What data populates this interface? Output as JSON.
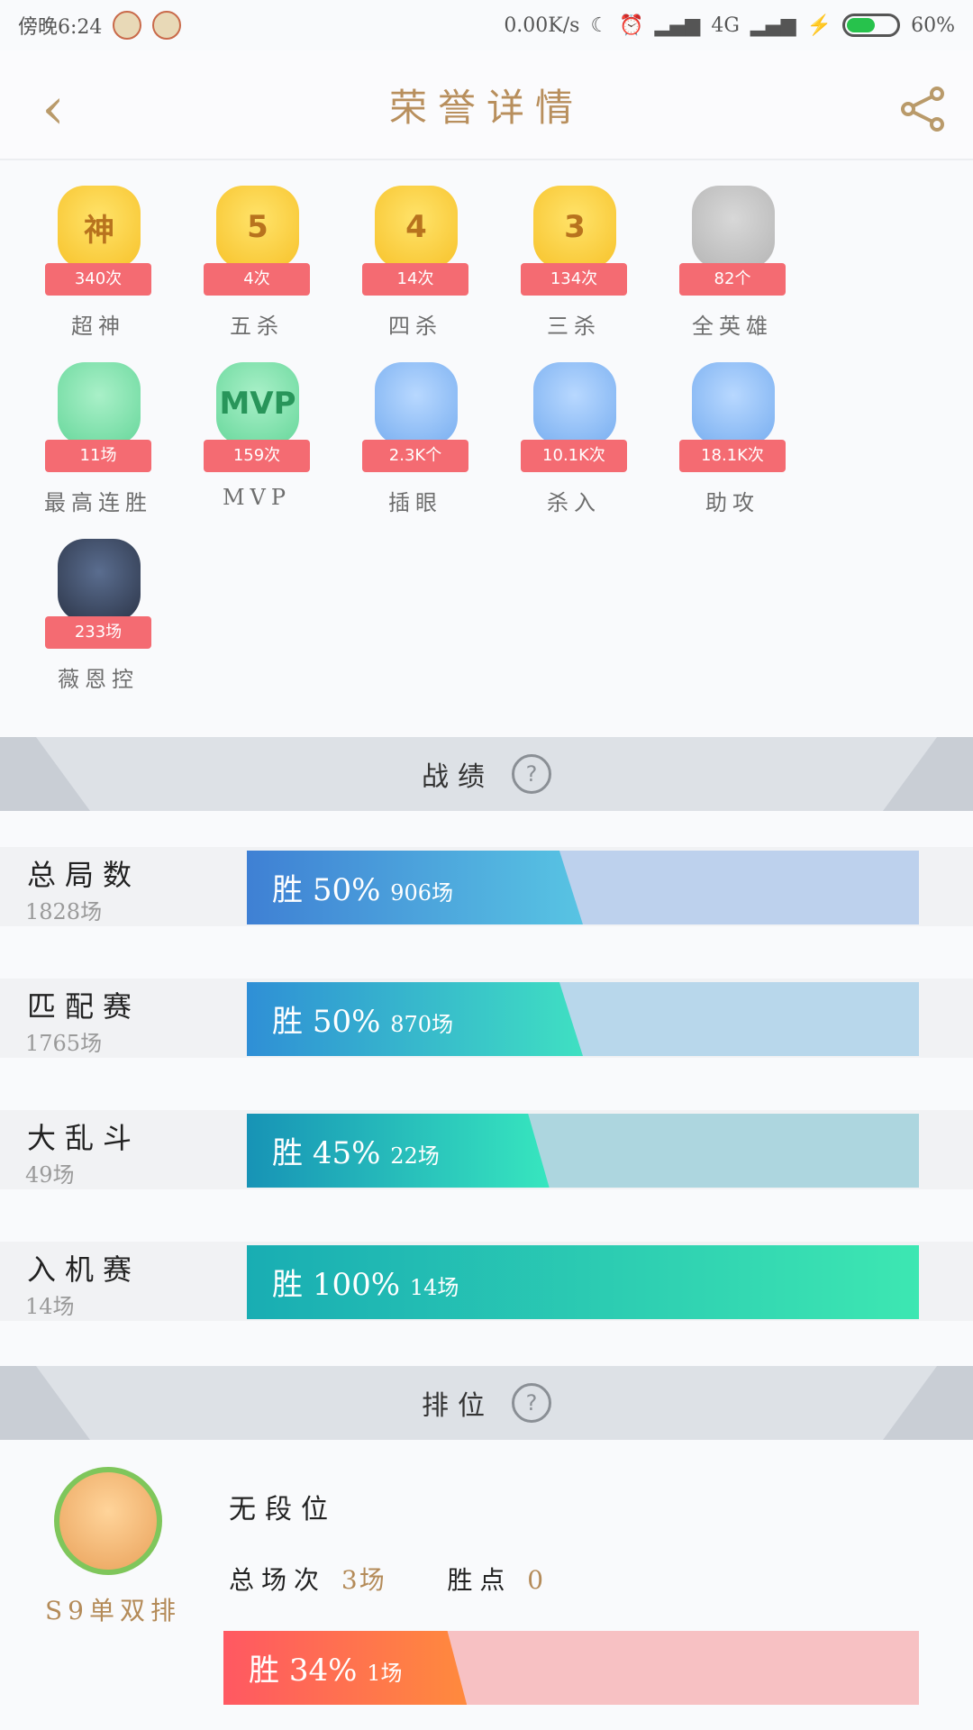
{
  "status_bar": {
    "time": "傍晚6:24",
    "net_speed": "0.00K/s",
    "signal": "4G",
    "battery": "60%",
    "battery_level": 0.6
  },
  "header": {
    "title": "荣誉详情"
  },
  "honors": [
    {
      "label": "超神",
      "count": "340次",
      "badge_text": "神",
      "color": "gold"
    },
    {
      "label": "五杀",
      "count": "4次",
      "badge_text": "5",
      "color": "gold"
    },
    {
      "label": "四杀",
      "count": "14次",
      "badge_text": "4",
      "color": "gold"
    },
    {
      "label": "三杀",
      "count": "134次",
      "badge_text": "3",
      "color": "gold"
    },
    {
      "label": "全英雄",
      "count": "82个",
      "badge_text": "",
      "color": "gray"
    },
    {
      "label": "最高连胜",
      "count": "11场",
      "badge_text": "",
      "color": "green"
    },
    {
      "label": "MVP",
      "count": "159次",
      "badge_text": "MVP",
      "color": "green"
    },
    {
      "label": "插眼",
      "count": "2.3K个",
      "badge_text": "",
      "color": "blue"
    },
    {
      "label": "杀入",
      "count": "10.1K次",
      "badge_text": "",
      "color": "blue"
    },
    {
      "label": "助攻",
      "count": "18.1K次",
      "badge_text": "",
      "color": "blue"
    },
    {
      "label": "薇恩控",
      "count": "233场",
      "badge_text": "",
      "color": "avatar"
    }
  ],
  "stats_section": {
    "title": "战绩",
    "help": "?"
  },
  "stats": [
    {
      "name": "总局数",
      "total": "1828场",
      "win_label": "胜",
      "win_rate_text": "50%",
      "win_games": "906场",
      "win_rate": 0.5,
      "color_from": "#3f80d4",
      "color_to": "#58c4e3",
      "track": "#bdd1ed"
    },
    {
      "name": "匹配赛",
      "total": "1765场",
      "win_label": "胜",
      "win_rate_text": "50%",
      "win_games": "870场",
      "win_rate": 0.5,
      "color_from": "#2f8fd6",
      "color_to": "#3fe0c2",
      "track": "#b8d7eb"
    },
    {
      "name": "大乱斗",
      "total": "49场",
      "win_label": "胜",
      "win_rate_text": "45%",
      "win_games": "22场",
      "win_rate": 0.45,
      "color_from": "#1793b6",
      "color_to": "#37e6bf",
      "track": "#add6df"
    },
    {
      "name": "入机赛",
      "total": "14场",
      "win_label": "胜",
      "win_rate_text": "100%",
      "win_games": "14场",
      "win_rate": 1.0,
      "color_from": "#19adb3",
      "color_to": "#3de7b2",
      "track": "#b1e2de"
    }
  ],
  "rank_section": {
    "title": "排位",
    "help": "?",
    "season": "S9单双排",
    "tier": "无段位",
    "total_label": "总场次",
    "total_value": "3场",
    "points_label": "胜点",
    "points_value": "0",
    "win_label": "胜",
    "win_rate_text": "34%",
    "win_games": "1场",
    "win_rate": 0.34
  }
}
